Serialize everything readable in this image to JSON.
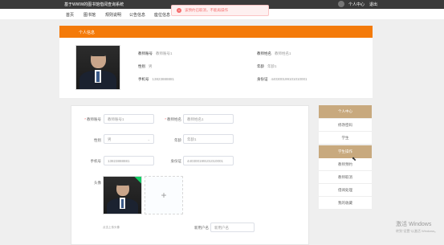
{
  "header": {
    "system_title": "基于WWW的图书馆借阅查询系统",
    "user_center": "个人中心",
    "logout": "退出"
  },
  "nav": {
    "items": [
      "首页",
      "图书馆",
      "规则说明",
      "公告信息",
      "座位信息"
    ]
  },
  "toast": {
    "message": "该预约已取消，不能再操作",
    "icon": "error-icon"
  },
  "profile": {
    "header_title": "个人信息",
    "fields": {
      "teacher_no_label": "教师账号",
      "teacher_no": "教师账号1",
      "teacher_name_label": "教师姓名",
      "teacher_name": "教师姓名1",
      "gender_label": "性别",
      "gender": "男",
      "age_label": "年龄",
      "age": "年龄1",
      "phone_label": "手机号",
      "phone": "13823888881",
      "id_card_label": "身份证",
      "id_card": "440300199101010001"
    }
  },
  "form": {
    "teacher_no_label": "教师账号",
    "teacher_no_value": "教师账号1",
    "teacher_name_label": "教师姓名",
    "teacher_name_value": "教师姓名1",
    "gender_label": "性别",
    "gender_value": "男",
    "age_label": "年龄",
    "age_value": "年龄1",
    "phone_label": "手机号",
    "phone_value": "13823888881",
    "id_card_label": "身份证",
    "id_card_value": "440300199101010001",
    "avatar_label": "头像",
    "upload_plus": "+",
    "upload_hint": "点击上传头像",
    "extra_label": "新用户名",
    "extra_value": "新用户名"
  },
  "side_menu": {
    "items": [
      "个人中心",
      "修改密码",
      "学生",
      "学生操作",
      "教师预约",
      "教师取消",
      "借阅处理",
      "我的收藏"
    ]
  },
  "watermark": {
    "title": "激活 Windows",
    "subtitle": "转到\"设置\"以激活 Windows。"
  },
  "colors": {
    "accent_orange": "#f47a09",
    "menu_highlight": "#c8a97e",
    "error_red": "#f56c6c"
  }
}
